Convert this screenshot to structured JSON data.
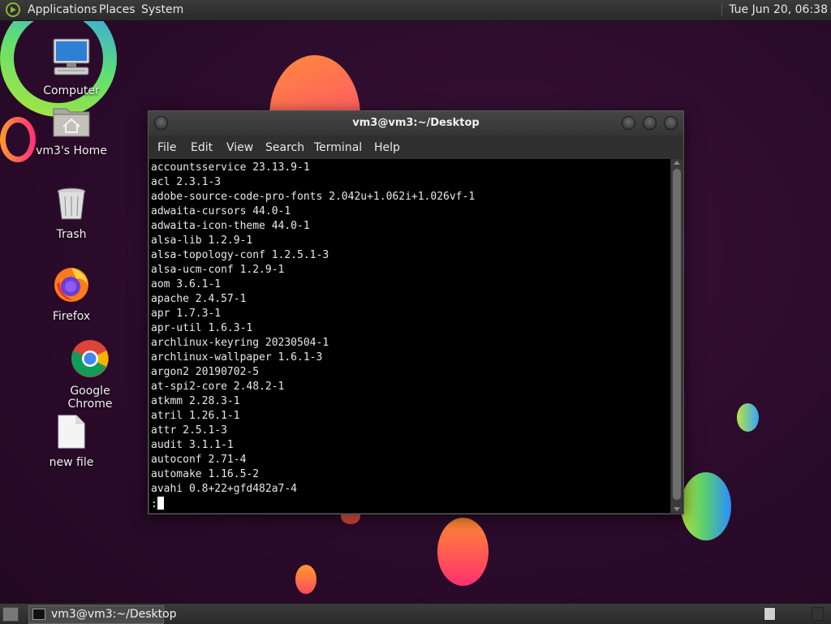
{
  "top_panel": {
    "menus": [
      "Applications",
      "Places",
      "System"
    ],
    "clock": "Tue Jun 20, 06:38"
  },
  "desktop_icons": [
    {
      "label": "Computer",
      "icon": "computer-icon"
    },
    {
      "label": "vm3's Home",
      "icon": "home-folder-icon"
    },
    {
      "label": "Trash",
      "icon": "trash-icon"
    },
    {
      "label": "Firefox",
      "icon": "firefox-icon"
    },
    {
      "label": "Google Chrome",
      "icon": "chrome-icon"
    },
    {
      "label": "new file",
      "icon": "file-icon"
    }
  ],
  "terminal": {
    "title": "vm3@vm3:~/Desktop",
    "menu": [
      "File",
      "Edit",
      "View",
      "Search",
      "Terminal",
      "Help"
    ],
    "lines": [
      "accountsservice 23.13.9-1",
      "acl 2.3.1-3",
      "adobe-source-code-pro-fonts 2.042u+1.062i+1.026vf-1",
      "adwaita-cursors 44.0-1",
      "adwaita-icon-theme 44.0-1",
      "alsa-lib 1.2.9-1",
      "alsa-topology-conf 1.2.5.1-3",
      "alsa-ucm-conf 1.2.9-1",
      "aom 3.6.1-1",
      "apache 2.4.57-1",
      "apr 1.7.3-1",
      "apr-util 1.6.3-1",
      "archlinux-keyring 20230504-1",
      "archlinux-wallpaper 1.6.1-3",
      "argon2 20190702-5",
      "at-spi2-core 2.48.2-1",
      "atkmm 2.28.3-1",
      "atril 1.26.1-1",
      "attr 2.5.1-3",
      "audit 3.1.1-1",
      "autoconf 2.71-4",
      "automake 1.16.5-2",
      "avahi 0.8+22+gfd482a7-4"
    ],
    "prompt": ":"
  },
  "taskbar": {
    "task_label": "vm3@vm3:~/Desktop"
  },
  "colors": {
    "wallpaper": "#2b0b2b",
    "terminal_bg": "#000000",
    "panel_bg": "#333333"
  }
}
